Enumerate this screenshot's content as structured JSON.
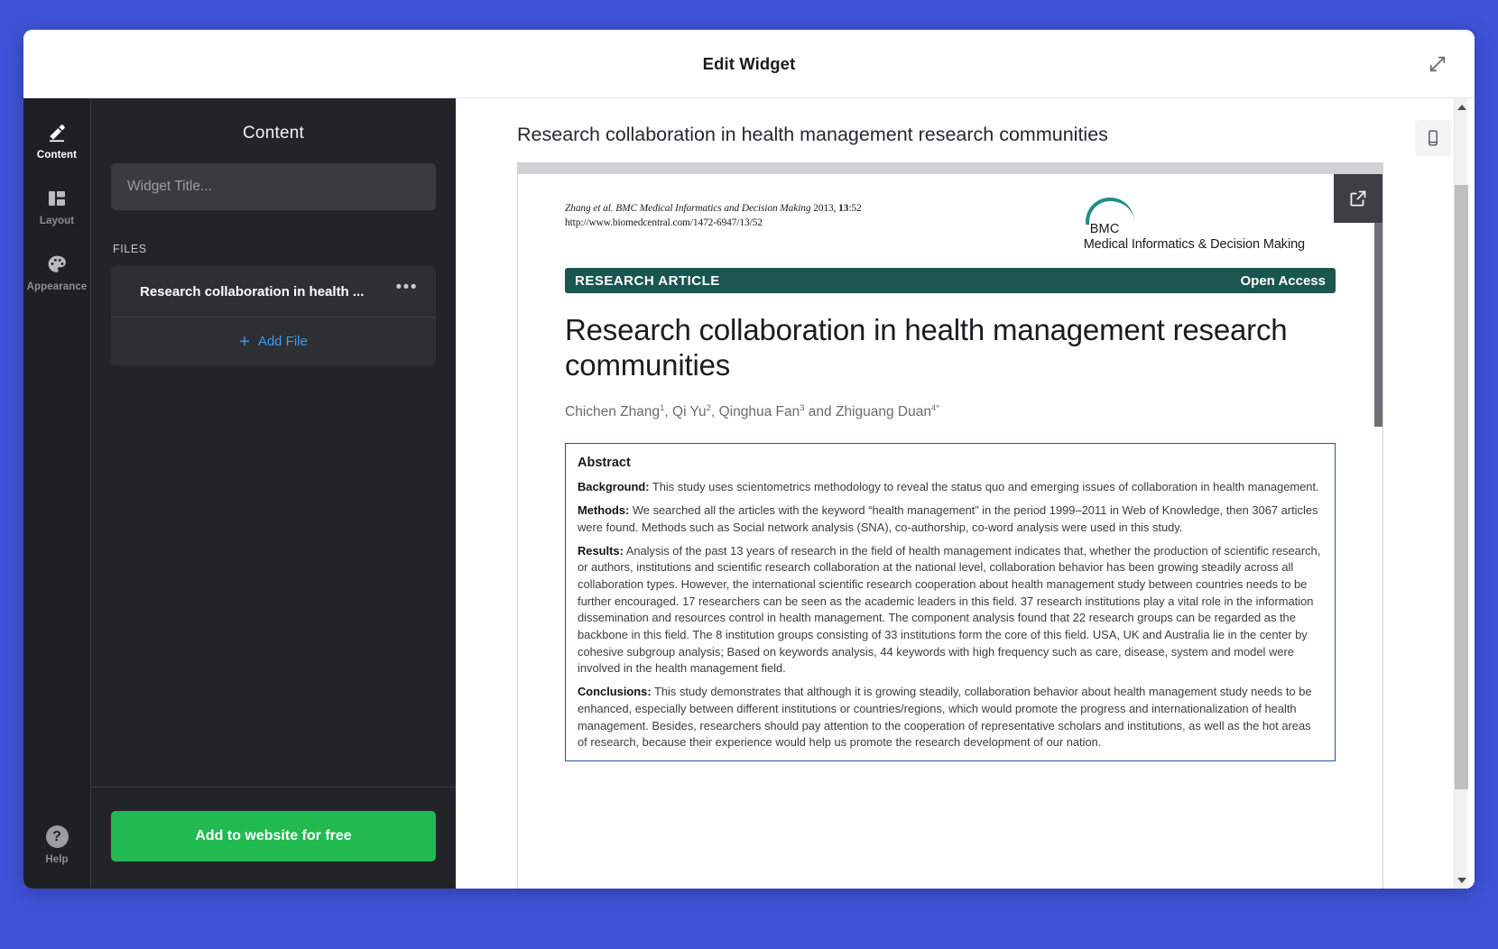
{
  "window": {
    "title": "Edit Widget",
    "expand_icon": "expand-diagonal-icon",
    "accent_background": "#3f53d9"
  },
  "rail": {
    "items": [
      {
        "label": "Content",
        "icon": "pencil-icon",
        "active": true
      },
      {
        "label": "Layout",
        "icon": "layout-columns-icon",
        "active": false
      },
      {
        "label": "Appearance",
        "icon": "palette-icon",
        "active": false
      }
    ],
    "help": {
      "label": "Help",
      "icon": "question-mark-icon",
      "glyph": "?"
    }
  },
  "panel": {
    "heading": "Content",
    "title_input": {
      "value": "",
      "placeholder": "Widget Title..."
    },
    "files_label": "FILES",
    "files": [
      {
        "name": "Research collaboration in health ...",
        "more_icon": "ellipsis-icon",
        "more_glyph": "•••"
      }
    ],
    "add_file": {
      "label": "Add File",
      "icon": "plus-icon",
      "glyph": "+"
    },
    "cta": {
      "label": "Add to website for free",
      "color": "#21ba51"
    }
  },
  "preview": {
    "title": "Research collaboration in health management research communities",
    "external_link_icon": "external-link-icon",
    "mobile_preview_icon": "mobile-phone-icon",
    "scroll_up_icon": "triangle-up-icon",
    "scroll_down_icon": "triangle-down-icon",
    "document": {
      "citation_line1_a": "Zhang et al. BMC Medical Informatics and Decision Making",
      "citation_line1_b": " 2013, ",
      "citation_line1_vol": "13",
      "citation_line1_c": ":52",
      "citation_line2": "http://www.biomedcentral.com/1472-6947/13/52",
      "journal_logo": {
        "brand": "BMC",
        "subtitle": "Medical Informatics & Decision Making",
        "arc_color": "#1f8f86"
      },
      "banner": {
        "left": "RESEARCH ARTICLE",
        "right": "Open Access",
        "color": "#1b5550"
      },
      "title": "Research collaboration in health management research communities",
      "authors_parts": [
        {
          "name": "Chichen Zhang",
          "sup": "1"
        },
        {
          "name": ", Qi Yu",
          "sup": "2"
        },
        {
          "name": ", Qinghua Fan",
          "sup": "3"
        },
        {
          "name": " and Zhiguang Duan",
          "sup": "4*"
        }
      ],
      "abstract": {
        "heading": "Abstract",
        "sections": [
          {
            "label": "Background:",
            "text": " This study uses scientometrics methodology to reveal the status quo and emerging issues of collaboration in health management."
          },
          {
            "label": "Methods:",
            "text": " We searched all the articles with the keyword “health management” in the period 1999–2011 in Web of Knowledge, then 3067 articles were found. Methods such as Social network analysis (SNA), co-authorship, co-word analysis were used in this study."
          },
          {
            "label": "Results:",
            "text": " Analysis of the past 13 years of research in the field of health management indicates that, whether the production of scientific research, or authors, institutions and scientific research collaboration at the national level, collaboration behavior has been growing steadily across all collaboration types. However, the international scientific research cooperation about health management study between countries needs to be further encouraged. 17 researchers can be seen as the academic leaders in this field. 37 research institutions play a vital role in the information dissemination and resources control in health management. The component analysis found that 22 research groups can be regarded as the backbone in this field. The 8 institution groups consisting of 33 institutions form the core of this field. USA, UK and Australia lie in the center by cohesive subgroup analysis; Based on keywords analysis, 44 keywords with high frequency such as care, disease, system and model were involved in the health management field."
          },
          {
            "label": "Conclusions:",
            "text": " This study demonstrates that although it is growing steadily, collaboration behavior about health management study needs to be enhanced, especially between different institutions or countries/regions, which would promote the progress and internationalization of health management. Besides, researchers should pay attention to the cooperation of representative scholars and institutions, as well as the hot areas of research, because their experience would help us promote the research development of our nation."
          }
        ]
      }
    }
  }
}
